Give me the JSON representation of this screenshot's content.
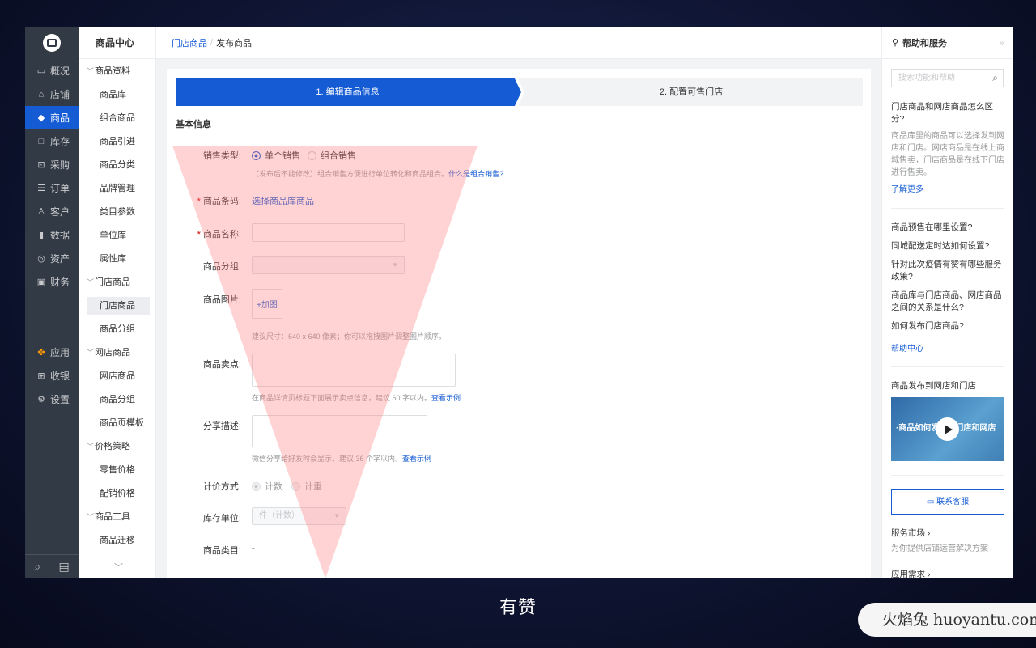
{
  "nav1": {
    "items": [
      {
        "label": "概况",
        "icon": "monitor-icon"
      },
      {
        "label": "店铺",
        "icon": "store-icon"
      },
      {
        "label": "商品",
        "icon": "tag-icon"
      },
      {
        "label": "库存",
        "icon": "warehouse-icon"
      },
      {
        "label": "采购",
        "icon": "purchase-icon"
      },
      {
        "label": "订单",
        "icon": "order-icon"
      },
      {
        "label": "客户",
        "icon": "user-icon"
      },
      {
        "label": "数据",
        "icon": "chart-icon"
      },
      {
        "label": "资产",
        "icon": "asset-icon"
      },
      {
        "label": "财务",
        "icon": "finance-icon"
      }
    ],
    "lower": [
      {
        "label": "应用",
        "icon": "apps-icon"
      },
      {
        "label": "收银",
        "icon": "cashier-icon"
      },
      {
        "label": "设置",
        "icon": "gear-icon"
      }
    ]
  },
  "nav2": {
    "title": "商品中心",
    "groups": [
      {
        "label": "商品资料",
        "items": [
          "商品库",
          "组合商品",
          "商品引进",
          "商品分类",
          "品牌管理",
          "类目参数",
          "单位库",
          "属性库"
        ]
      },
      {
        "label": "门店商品",
        "items": [
          "门店商品",
          "商品分组"
        ]
      },
      {
        "label": "网店商品",
        "items": [
          "网店商品",
          "商品分组",
          "商品页模板"
        ]
      },
      {
        "label": "价格策略",
        "items": [
          "零售价格",
          "配销价格"
        ]
      },
      {
        "label": "商品工具",
        "items": [
          "商品迁移"
        ]
      }
    ]
  },
  "header": {
    "crumb_link": "门店商品",
    "sep": "/",
    "crumb_current": "发布商品"
  },
  "steps": {
    "step1": "1. 编辑商品信息",
    "step2": "2. 配置可售门店"
  },
  "section_title": "基本信息",
  "form": {
    "sale_type_label": "销售类型:",
    "sale_single": "单个销售",
    "sale_combo": "组合销售",
    "sale_hint": "（发布后不能修改）组合销售方便进行单位转化和商品组合。",
    "sale_hint_link": "什么是组合销售?",
    "barcode_label": "商品条码:",
    "barcode_link": "选择商品库商品",
    "name_label": "商品名称:",
    "group_label": "商品分组:",
    "image_label": "商品图片:",
    "image_add": "+加图",
    "image_hint": "建议尺寸：640 x 640 像素；你可以拖拽图片调整图片顺序。",
    "selling_label": "商品卖点:",
    "selling_hint": "在商品详情页标题下面展示卖点信息，建议 60 字以内。",
    "selling_link": "查看示例",
    "share_label": "分享描述:",
    "share_hint": "微信分享给好友时会显示，建议 36 个字以内。",
    "share_link": "查看示例",
    "price_label": "计价方式:",
    "price_count": "计数",
    "price_weight": "计重",
    "stock_unit_label": "库存单位:",
    "stock_unit_value": "件（计数）",
    "category_label": "商品类目:",
    "category_value": "-"
  },
  "right": {
    "title": "帮助和服务",
    "collapse": "»",
    "search_placeholder": "搜索功能和帮助",
    "q1_title": "门店商品和网店商品怎么区分?",
    "q1_desc": "商品库里的商品可以选择发到网店和门店。网店商品是在线上商城售卖，门店商品是在线下门店进行售卖。",
    "q1_more": "了解更多",
    "faq": [
      "商品预售在哪里设置?",
      "同城配送定时达如何设置?",
      "针对此次疫情有赞有哪些服务政策?",
      "商品库与门店商品、网店商品之间的关系是什么?",
      "如何发布门店商品?"
    ],
    "help_center": "帮助中心",
    "video_title": "商品发布到网店和门店",
    "video_overlay": "·商品如何发布到门店和网店",
    "contact": "联系客服",
    "market_title": "服务市场 ›",
    "market_desc": "为你提供店铺运营解决方案",
    "app_need": "应用需求 ›"
  },
  "caption": "有赞",
  "watermark": "火焰兔 huoyantu.com",
  "colors": {
    "brand": "#155bd4",
    "nav_bg": "#323a45",
    "overlay": "#ff8080"
  }
}
